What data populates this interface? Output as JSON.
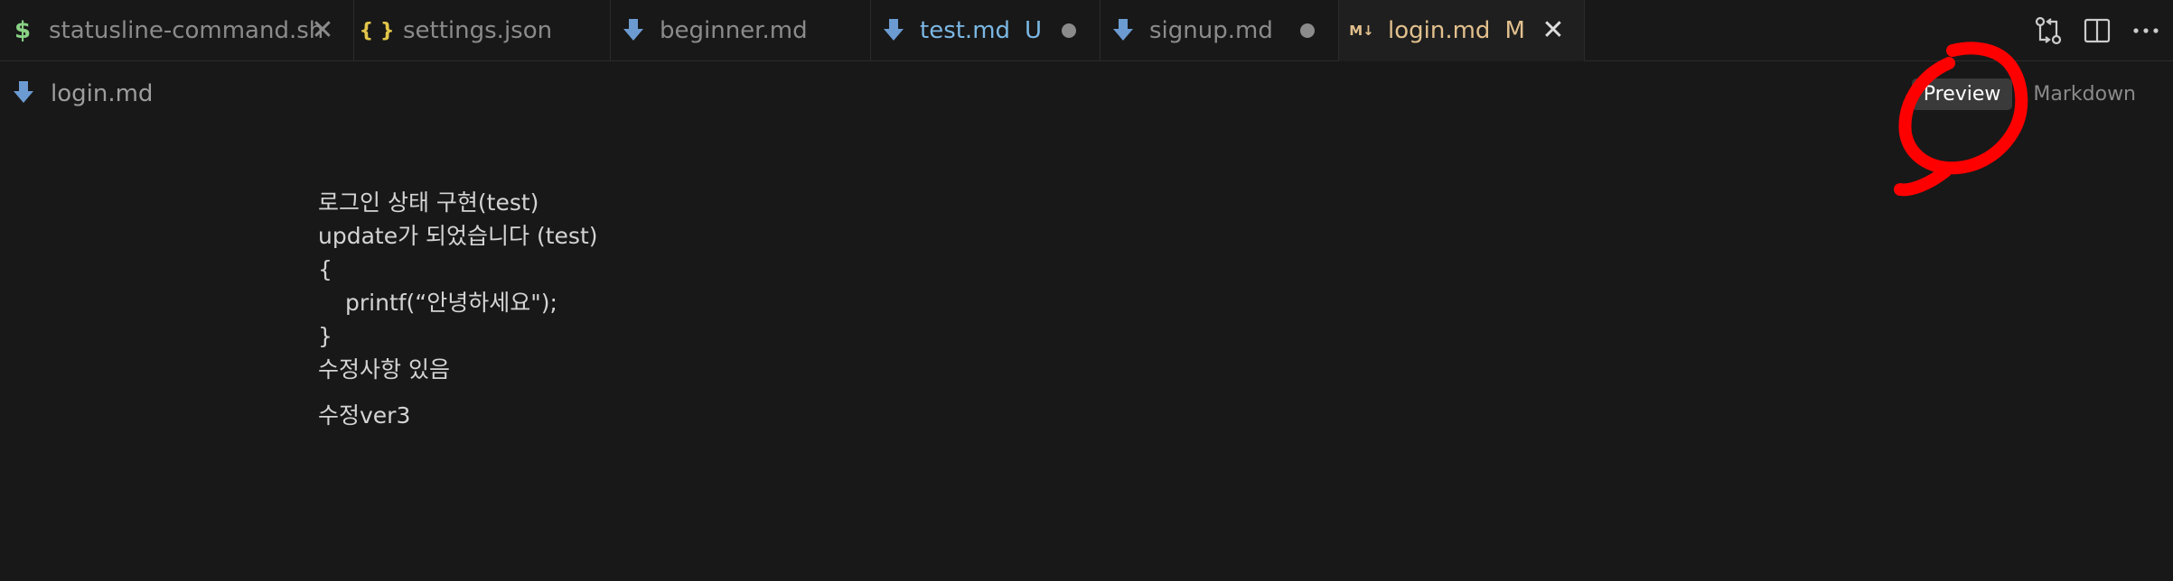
{
  "tabs": [
    {
      "label": "statusline-command.sh",
      "icon": "dollar-icon",
      "icon_glyph": "$",
      "icon_color": "#89d185",
      "state": "close",
      "active": false
    },
    {
      "label": "settings.json",
      "icon": "braces-icon",
      "icon_glyph": "{ }",
      "icon_color": "#e2c54a",
      "state": "none",
      "active": false
    },
    {
      "label": "beginner.md",
      "icon": "markdown-download-icon",
      "icon_color": "#6b9bd1",
      "state": "none",
      "active": false
    },
    {
      "label": "test.md",
      "badge": "U",
      "icon": "markdown-download-icon",
      "icon_color": "#6b9bd1",
      "state": "dot",
      "active": false,
      "label_color": "#7bb7e3"
    },
    {
      "label": "signup.md",
      "icon": "markdown-download-icon",
      "icon_color": "#6b9bd1",
      "state": "dot",
      "active": false
    },
    {
      "label": "login.md",
      "badge": "M",
      "icon": "markdown-m-icon",
      "icon_glyph": "M↓",
      "icon_color": "#e2c08d",
      "state": "close",
      "active": true
    }
  ],
  "breadcrumb": {
    "file": "login.md"
  },
  "view_toggle": {
    "preview": "Preview",
    "markdown": "Markdown"
  },
  "document": {
    "lines": [
      "로그인 상태 구현(test)",
      "update가 되었습니다 (test)",
      "{",
      "printf(“안녕하세요\");",
      "}",
      "수정사항 있음"
    ],
    "paragraph2": "수정ver3"
  },
  "colors": {
    "background": "#181818",
    "active_tab_text": "#e2c08d",
    "annotation": "#ff0000"
  }
}
